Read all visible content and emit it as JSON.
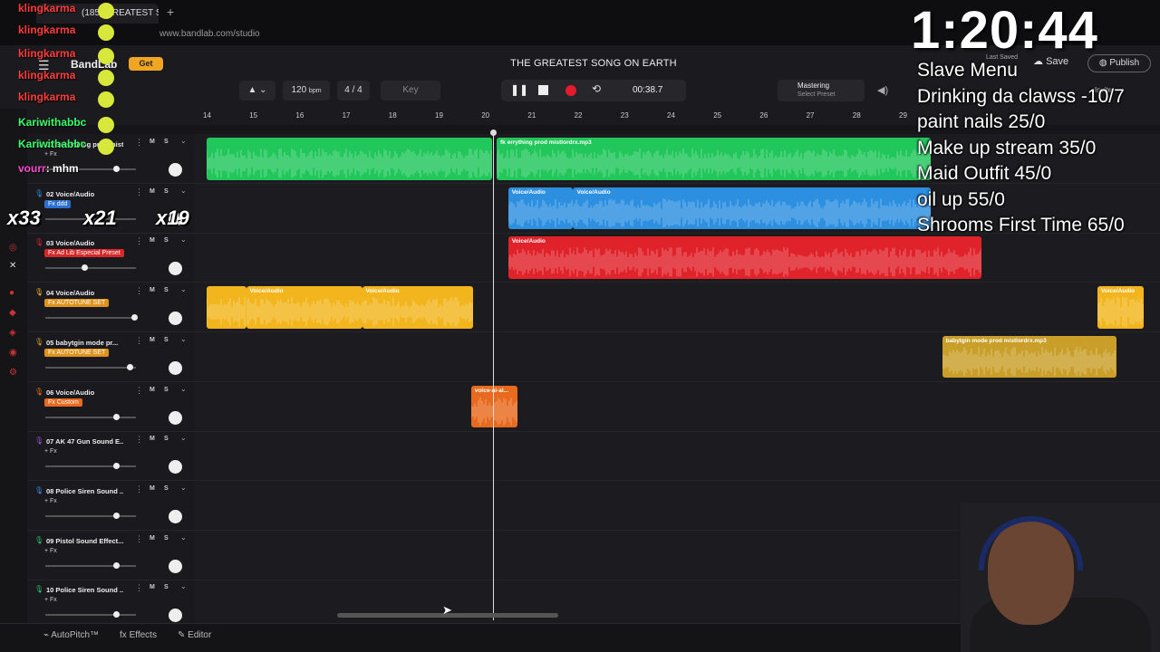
{
  "browser": {
    "tab_title": "(185) GREATEST S",
    "new_tab": "+",
    "url": "www.bandlab.com/studio"
  },
  "app": {
    "brand": "BandLab",
    "get_label": "Get",
    "song_title": "THE GREATEST SONG ON EARTH",
    "last_saved": "Last Saved",
    "save_label": "Save",
    "publish_label": "Publish",
    "invite_label": "Invite"
  },
  "toolbar": {
    "tempo": "120",
    "tempo_unit": "bpm",
    "meter": "4 / 4",
    "key_label": "Key",
    "time": "00:38.7",
    "mastering_label": "Mastering",
    "mastering_preset": "Select Preset"
  },
  "ruler": {
    "ticks": [
      "14",
      "15",
      "16",
      "17",
      "18",
      "19",
      "20",
      "21",
      "22",
      "23",
      "24",
      "25",
      "26",
      "27",
      "28",
      "29"
    ]
  },
  "tracks": [
    {
      "name": "01 Everything prod mistlordrx",
      "fx": "+ Fx",
      "color": "#22c75c"
    },
    {
      "name": "02 Voice/Audio",
      "fx": "Fx  ddd",
      "color": "#2d8fe0"
    },
    {
      "name": "03 Voice/Audio",
      "fx": "Fx  Ad Lib Especial Preset",
      "color": "#e0222a"
    },
    {
      "name": "04 Voice/Audio",
      "fx": "Fx  AUTOTUNE SET",
      "color": "#f2b51d"
    },
    {
      "name": "05 babytgin mode pr...",
      "fx": "Fx  AUTOTUNE SET",
      "color": "#c99f2a"
    },
    {
      "name": "06 Voice/Audio",
      "fx": "Fx  Custom",
      "color": "#e86a1f"
    },
    {
      "name": "07 AK 47 Gun Sound E...",
      "fx": "+ Fx",
      "color": "#9a52d6"
    },
    {
      "name": "08 Police Siren Sound ...",
      "fx": "+ Fx",
      "color": "#3c8bd6"
    },
    {
      "name": "09 Pistol Sound Effect...",
      "fx": "+ Fx",
      "color": "#2dbf6a"
    },
    {
      "name": "10 Police Siren Sound ...",
      "fx": "+ Fx",
      "color": "#2dbf6a"
    }
  ],
  "clips": [
    {
      "track": 0,
      "label": "",
      "start": 14.0,
      "end": 20.15
    },
    {
      "track": 0,
      "label": "fk errything prod mistlordrx.mp3",
      "start": 20.25,
      "end": 29.6
    },
    {
      "track": 1,
      "label": "Voice/Audio",
      "start": 20.5,
      "end": 21.9
    },
    {
      "track": 1,
      "label": "Voice/Audio",
      "start": 21.9,
      "end": 29.6
    },
    {
      "track": 2,
      "label": "Voice/Audio",
      "start": 20.5,
      "end": 30.7
    },
    {
      "track": 3,
      "label": "",
      "start": 14.0,
      "end": 14.85
    },
    {
      "track": 3,
      "label": "Voice/Audio",
      "start": 14.85,
      "end": 17.35
    },
    {
      "track": 3,
      "label": "Voice/Audio",
      "start": 17.35,
      "end": 19.75
    },
    {
      "track": 3,
      "label": "Voice/Audio",
      "start": 33.2,
      "end": 34.2
    },
    {
      "track": 4,
      "label": "babytgin mode prod mistlordrx.mp3",
      "start": 29.85,
      "end": 33.6
    },
    {
      "track": 5,
      "label": "voice-ai-al...",
      "start": 19.7,
      "end": 20.7
    }
  ],
  "bottom": {
    "autopitch": "AutoPitch™",
    "effects": "Effects",
    "editor": "Editor"
  },
  "overlay": {
    "clock": "1:20:44",
    "menu": [
      "Slave Menu",
      "Drinking da clawss -10/7",
      "paint nails 25/0",
      "Make up stream 35/0",
      "Maid Outfit 45/0",
      "oil up 55/0",
      "Shrooms First Time 65/0"
    ],
    "chat": [
      {
        "user": "klingkarma",
        "text": "",
        "color": "#ff3b3b"
      },
      {
        "user": "klingkarma",
        "text": "",
        "color": "#ff3b3b"
      },
      {
        "user": "klingkarma",
        "text": "",
        "color": "#ff3b3b"
      },
      {
        "user": "klingkarma",
        "text": "",
        "color": "#ff3b3b"
      },
      {
        "user": "klingkarma",
        "text": "",
        "color": "#ff3b3b"
      },
      {
        "user": "Kariwithabbc",
        "text": "",
        "color": "#3bff6a"
      },
      {
        "user": "Kariwithabbc",
        "text": "",
        "color": "#3bff6a"
      },
      {
        "user": "vourr",
        "text": ": mhm",
        "color": "#ff4bd2"
      }
    ],
    "badges": [
      "x33",
      "x21",
      "x19"
    ]
  },
  "colors": {
    "record": "#e31b2b",
    "playhead": "#dddddd",
    "accent": "#f0a623"
  }
}
